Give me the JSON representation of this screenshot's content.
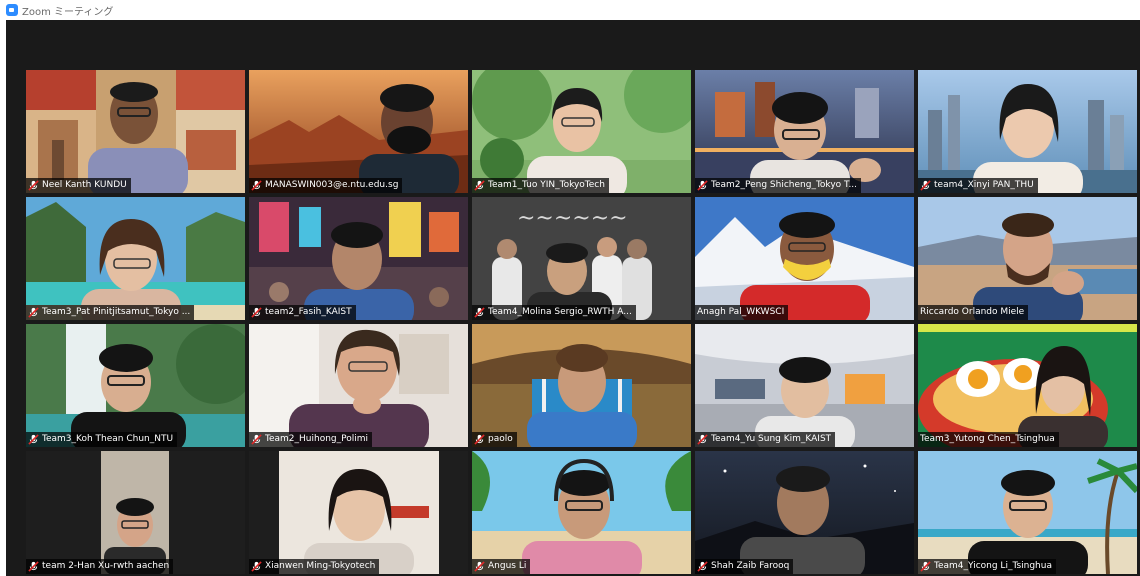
{
  "window": {
    "title": "Zoom ミーティング"
  },
  "colors": {
    "stage_bg": "#1a1a1a",
    "active_speaker_border": "#d6e64a",
    "muted_icon": "#e02828",
    "zoom_blue": "#2D8CFF"
  },
  "participants": [
    {
      "name": "Neel Kanth KUNDU",
      "muted": true
    },
    {
      "name": "MANASWIN003@e.ntu.edu.sg",
      "muted": true
    },
    {
      "name": "Team1_Tuo YIN_TokyoTech",
      "muted": true
    },
    {
      "name": "Team2_Peng Shicheng_Tokyo T...",
      "muted": true
    },
    {
      "name": "team4_Xinyi PAN_THU",
      "muted": true
    },
    {
      "name": "Team3_Pat Pinitjitsamut_Tokyo ...",
      "muted": true
    },
    {
      "name": "team2_Fasih_KAIST",
      "muted": true
    },
    {
      "name": "Team4_Molina Sergio_RWTH A...",
      "muted": true
    },
    {
      "name": "Anagh Pal_WKWSCI",
      "muted": false
    },
    {
      "name": "Riccardo Orlando Miele",
      "muted": false
    },
    {
      "name": "Team3_Koh Thean Chun_NTU",
      "muted": true
    },
    {
      "name": "Team2_Huihong_Polimi",
      "muted": true
    },
    {
      "name": "paolo",
      "muted": true
    },
    {
      "name": "Team4_Yu Sung Kim_KAIST",
      "muted": true
    },
    {
      "name": "Team3_Yutong Chen_Tsinghua",
      "muted": false,
      "active": true
    },
    {
      "name": "team 2-Han Xu-rwth aachen",
      "muted": true
    },
    {
      "name": "Xianwen Ming-Tokyotech",
      "muted": true
    },
    {
      "name": "Angus Li",
      "muted": true
    },
    {
      "name": "Shah Zaib Farooq",
      "muted": true
    },
    {
      "name": "Team4_Yicong Li_Tsinghua",
      "muted": true
    }
  ]
}
